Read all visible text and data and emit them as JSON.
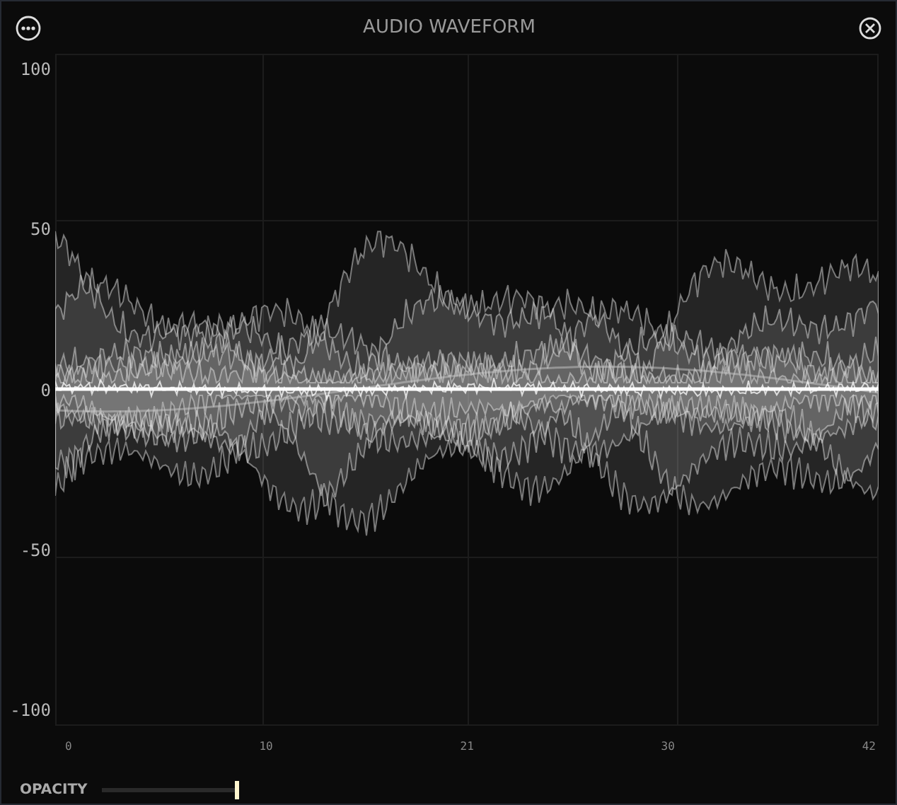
{
  "title": "AUDIO WAVEFORM",
  "y_axis_labels": [
    "100",
    "50",
    "0",
    "-50",
    "-100"
  ],
  "x_axis_labels": [
    "0",
    "10",
    "21",
    "30",
    "42"
  ],
  "opacity": {
    "label": "OPACITY",
    "level": 1
  }
}
